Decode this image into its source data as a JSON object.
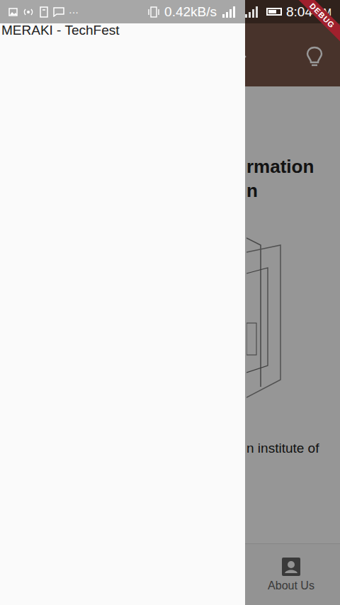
{
  "status_bar": {
    "dots": "···",
    "speed": "0.42kB/s",
    "time": "8:04",
    "meridiem": "PM",
    "battery_level": 0.6
  },
  "debug_banner": "DEBUG",
  "drawer": {
    "title": "MERAKI - TechFest"
  },
  "page": {
    "heading_lines": [
      "rmation",
      "n"
    ],
    "body_text": "n institute of"
  },
  "bottom_nav": [
    {
      "label": "About Us",
      "selected": false
    }
  ]
}
